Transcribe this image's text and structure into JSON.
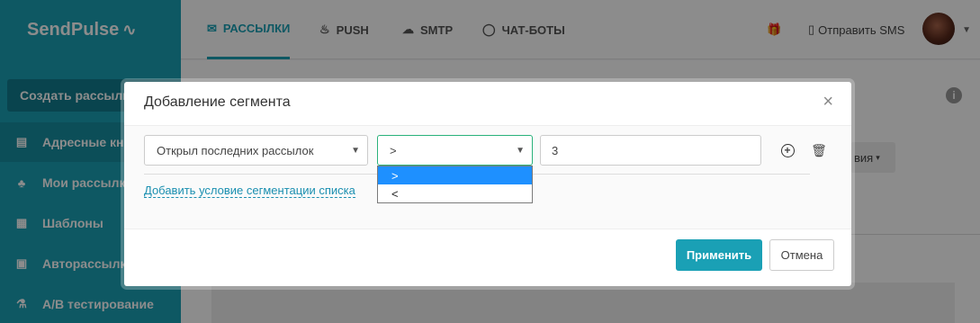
{
  "sidebar": {
    "logo": "SendPulse",
    "create_button": "Создать рассылку",
    "items": [
      {
        "label": "Адресные книги",
        "icon": "address-book-icon"
      },
      {
        "label": "Мои рассылки",
        "icon": "mailings-icon"
      },
      {
        "label": "Шаблоны",
        "icon": "templates-icon"
      },
      {
        "label": "Авторассылки",
        "icon": "autoresponder-icon"
      },
      {
        "label": "А/В тестирование",
        "icon": "ab-test-icon"
      }
    ]
  },
  "topbar": {
    "tabs": [
      {
        "label": "РАССЫЛКИ",
        "icon": "envelope-icon"
      },
      {
        "label": "PUSH",
        "icon": "bell-icon"
      },
      {
        "label": "SMTP",
        "icon": "cloud-icon"
      },
      {
        "label": "ЧАТ-БОТЫ",
        "icon": "chat-icon"
      }
    ],
    "send_sms": "Отправить SMS"
  },
  "background": {
    "dropdown_fragment": "вия"
  },
  "modal": {
    "title": "Добавление сегмента",
    "condition_select": "Открыл последних рассылок",
    "operator_select": ">",
    "value_input": "3",
    "operator_options": [
      ">",
      "<"
    ],
    "add_condition_link": "Добавить условие сегментации списка",
    "apply_button": "Применить",
    "cancel_button": "Отмена"
  },
  "colors": {
    "brand": "#1aa0b5",
    "link": "#1a8fb0",
    "selected_option": "#1e90ff"
  }
}
